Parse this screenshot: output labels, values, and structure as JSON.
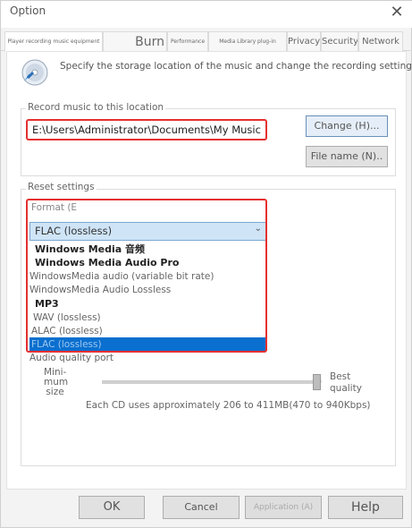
{
  "window": {
    "title": "Option",
    "close_glyph": "✕"
  },
  "tabs": [
    {
      "label": "Player recording music equipment"
    },
    {
      "label": "Burn"
    },
    {
      "label": "Performance"
    },
    {
      "label": "Media Library plug-in"
    },
    {
      "label": "Privacy"
    },
    {
      "label": "Security"
    },
    {
      "label": "Network"
    }
  ],
  "panel": {
    "icon": "cd-rip-icon",
    "description": "Specify the storage location of the music and change the recording settings."
  },
  "record_location": {
    "group_label": "Record music to this location",
    "path": "E:\\Users\\Administrator\\Documents\\My Music",
    "change_button": "Change (H)...",
    "file_name_button": "File name (N).."
  },
  "reset_settings": {
    "group_label": "Reset settings",
    "format_label": "Format (E",
    "selected_format": "FLAC (lossless)",
    "options": [
      "Windows Media 音频",
      "Windows Media Audio Pro",
      "WindowsMedia audio (variable bit rate)",
      "WindowsMedia Audio Lossless",
      "MP3",
      "WAV (lossless)",
      "ALAC (lossless)",
      "FLAC (lossless)"
    ]
  },
  "audio_quality": {
    "label": "Audio quality port",
    "min_label": "Mini-mum size",
    "max_label": "Best quality",
    "slider_value": 1.0,
    "estimate": "Each CD uses approximately 206 to 411MB(470 to 940Kbps)"
  },
  "buttons": {
    "ok": "OK",
    "cancel": "Cancel",
    "apply": "Application (A)",
    "help": "Help"
  },
  "colors": {
    "highlight_red": "#e53030",
    "selection_blue": "#0a6fcf"
  }
}
